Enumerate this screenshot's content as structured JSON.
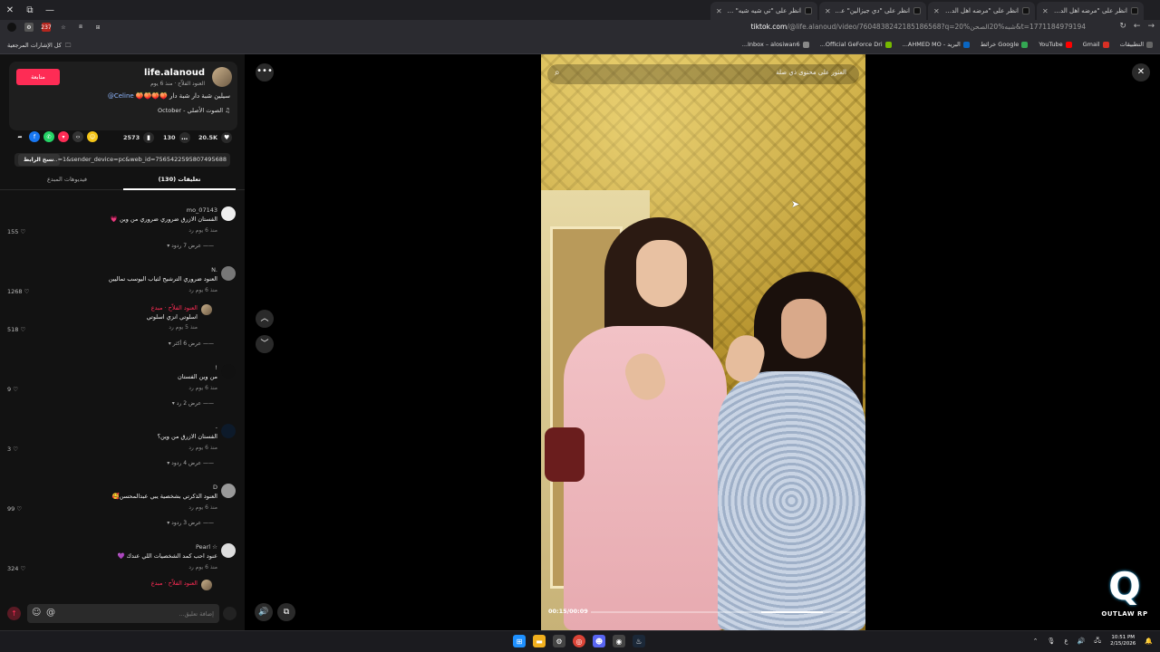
{
  "browser": {
    "tabs": [
      {
        "label": "انظر على \"تي شيه شيه\" على"
      },
      {
        "label": "انظر على \"دي جيزالين\" على TikTok"
      },
      {
        "label": "انظر على \"مرضه اهل الدمام\" على"
      },
      {
        "label": "انظر على \"مرضه اهل الدمام\" على"
      }
    ],
    "url_host": "tiktok.com",
    "url_rest": "/@life.alanoud/video/7604838242185186568?q=شبه%20الصحن%20&t=1771184979194",
    "ext_badge": "237",
    "bookmarks": [
      "التطبيقات",
      "Gmail",
      "YouTube",
      "Google خرائط",
      "البريد - AHMED MO...",
      "Official GeForce Dri...",
      "Inbox – alosiwan6..."
    ],
    "bookmarks_left": "كل الإشارات المرجعية"
  },
  "author": {
    "username": "life.alanoud",
    "subtitle": "العنود الفلاّح · منذ 6 يوم",
    "follow_label": "متابعة",
    "description": "سيلين شبة دار شبة دار 🍑🍑🍑🍑",
    "mention": "Celine@",
    "music": "الصوت الأصلي - October"
  },
  "stats": {
    "likes": "20.5K",
    "comments": "130",
    "saves": "2573"
  },
  "share_link": {
    "text": "...=1&sender_device=pc&web_id=7565422595807495688",
    "copy_label": "نسخ الرابط"
  },
  "panel_tabs": {
    "comments": "(130) تعليقات",
    "creator_videos": "فيديوهات المبدع"
  },
  "comments": [
    {
      "user": "mo_07143",
      "text": "الفستان الازرق ضروري ضروري من وين 💗",
      "meta": "منذ 6 يوم   رد",
      "likes": "155",
      "replies": "عرض 7 ردود"
    },
    {
      "user": "N.",
      "text": "العنود ضروري الترشيح لثياب اليوسب تماليين",
      "meta": "منذ 6 يوم   رد",
      "likes": "1268",
      "replies": "",
      "reply": {
        "user": "العنود الفلاّح · مبدع",
        "text": "اسلوتي انزي اسلوتي",
        "meta": "منذ 5 يوم   رد"
      },
      "reply_likes": "518",
      "more_replies": "عرض 6 أكثر"
    },
    {
      "user": "!",
      "text": "من وين الفستان",
      "meta": "منذ 6 يوم   رد",
      "likes": "9",
      "replies": "عرض 2 رد"
    },
    {
      "user": "-",
      "text": "الفستان الازرق من وين؟",
      "meta": "منذ 6 يوم   رد",
      "likes": "3",
      "replies": "عرض 4 ردود"
    },
    {
      "user": "D",
      "text": "العنود الذكرتي بشخصية يبي عبدالمحسن🥰",
      "meta": "منذ 6 يوم   رد",
      "likes": "99",
      "replies": "عرض 3 ردود"
    },
    {
      "user": "Pearl ☆",
      "text": "عنود احب كمد الشخصيات اللي عندك 💜",
      "meta": "منذ 6 يوم   رد",
      "likes": "324",
      "replies": "",
      "reply": {
        "user": "العنود الفلاّح · مبدع",
        "text": "",
        "meta": ""
      }
    }
  ],
  "comment_input": {
    "placeholder": "إضافة تعليق..."
  },
  "video": {
    "search_placeholder": "العثور على محتوى ذي صلة",
    "timecode": "00:15/00:09",
    "progress": 0.64
  },
  "watermark": {
    "text": "OUTLAW RP"
  },
  "taskbar": {
    "time": "10:51 PM",
    "date": "2/15/2026"
  },
  "colors": {
    "accent": "#fe2c55",
    "panel_bg": "#121212",
    "video_gold": "#c8a43c"
  }
}
